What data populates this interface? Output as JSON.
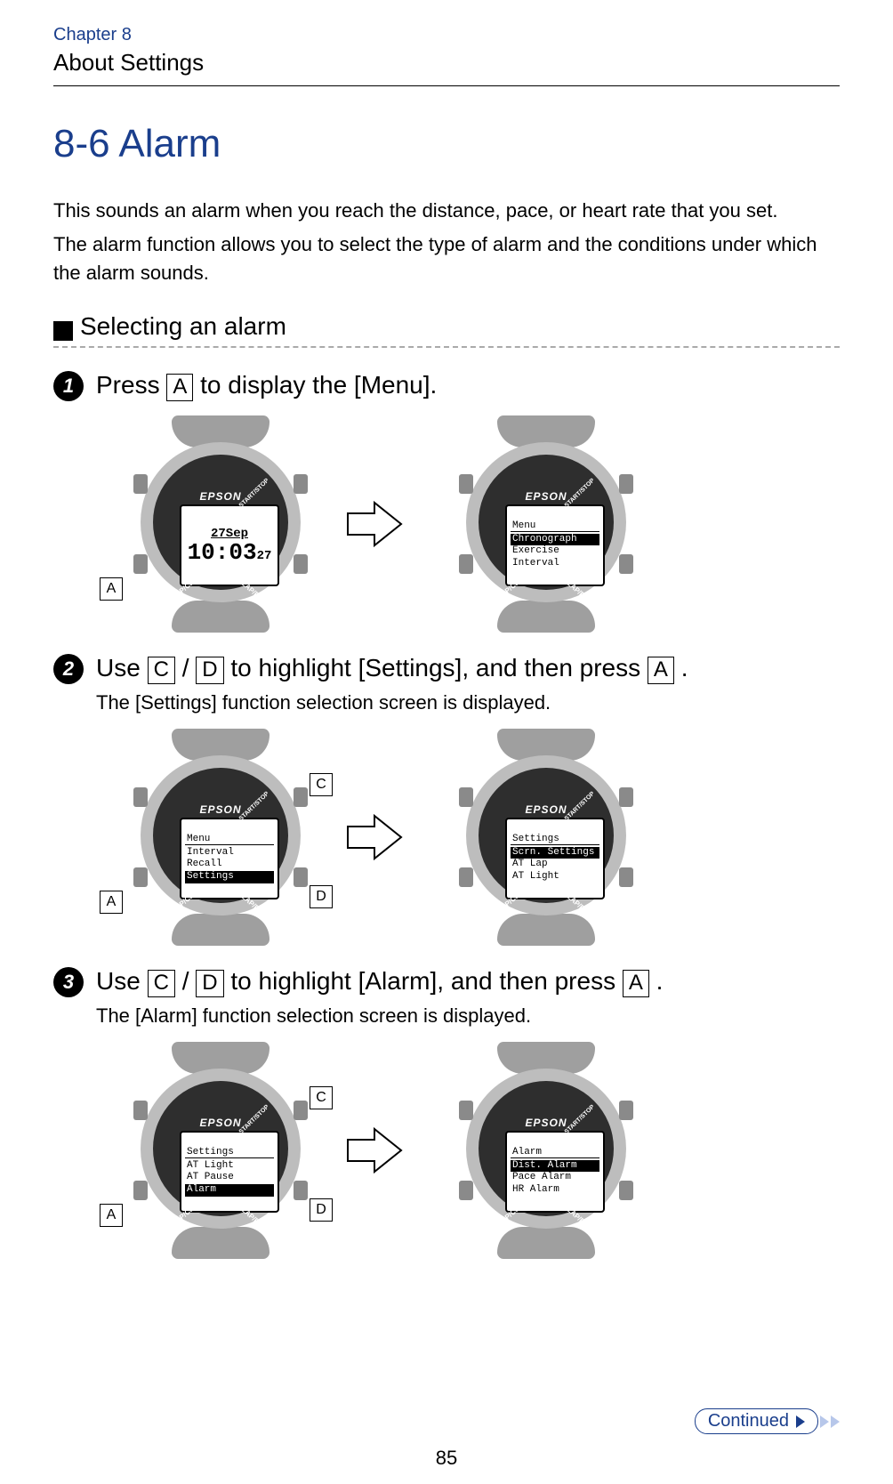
{
  "chapter": "Chapter 8",
  "section": "About Settings",
  "heading": "8-6 Alarm",
  "intro": {
    "p1": "This sounds an alarm when you reach the distance, pace, or heart rate that you set.",
    "p2": "The alarm function allows you to select the type of alarm and the conditions under which the alarm sounds."
  },
  "subhead": "Selecting an alarm",
  "keys": {
    "A": "A",
    "C": "C",
    "D": "D"
  },
  "steps": {
    "s1": {
      "num": "1",
      "title_pre": "Press ",
      "title_post": " to display the [Menu]."
    },
    "s2": {
      "num": "2",
      "title_pre": "Use ",
      "title_mid": " / ",
      "title_mid2": " to highlight [Settings], and then press ",
      "title_end": ".",
      "desc": "The [Settings] function selection screen is displayed."
    },
    "s3": {
      "num": "3",
      "title_pre": "Use ",
      "title_mid": " / ",
      "title_mid2": " to highlight [Alarm], and then press ",
      "title_end": ".",
      "desc": "The [Alarm] function selection screen is displayed."
    }
  },
  "watch": {
    "brand": "EPSON",
    "labels": {
      "disp": "DISP/CHG",
      "lap": "LAP/RESET",
      "start": "START/STOP"
    },
    "clock": {
      "date": "27Sep",
      "time": "10:03",
      "sec": "27"
    },
    "menu1": {
      "title": "Menu",
      "l1": "Chronograph",
      "l2": "Exercise",
      "l3": "Interval"
    },
    "menu2l": {
      "title": "Menu",
      "l1": "Interval",
      "l2": "Recall",
      "l3": "Settings"
    },
    "menu2r": {
      "title": "Settings",
      "l1": "Scrn. Settings",
      "l2": "AT Lap",
      "l3": "AT Light"
    },
    "menu3l": {
      "title": "Settings",
      "l1": "AT Light",
      "l2": "AT Pause",
      "l3": "Alarm"
    },
    "menu3r": {
      "title": "Alarm",
      "l1": "Dist. Alarm",
      "l2": "Pace Alarm",
      "l3": "HR Alarm"
    }
  },
  "continued": "Continued",
  "page": "85"
}
